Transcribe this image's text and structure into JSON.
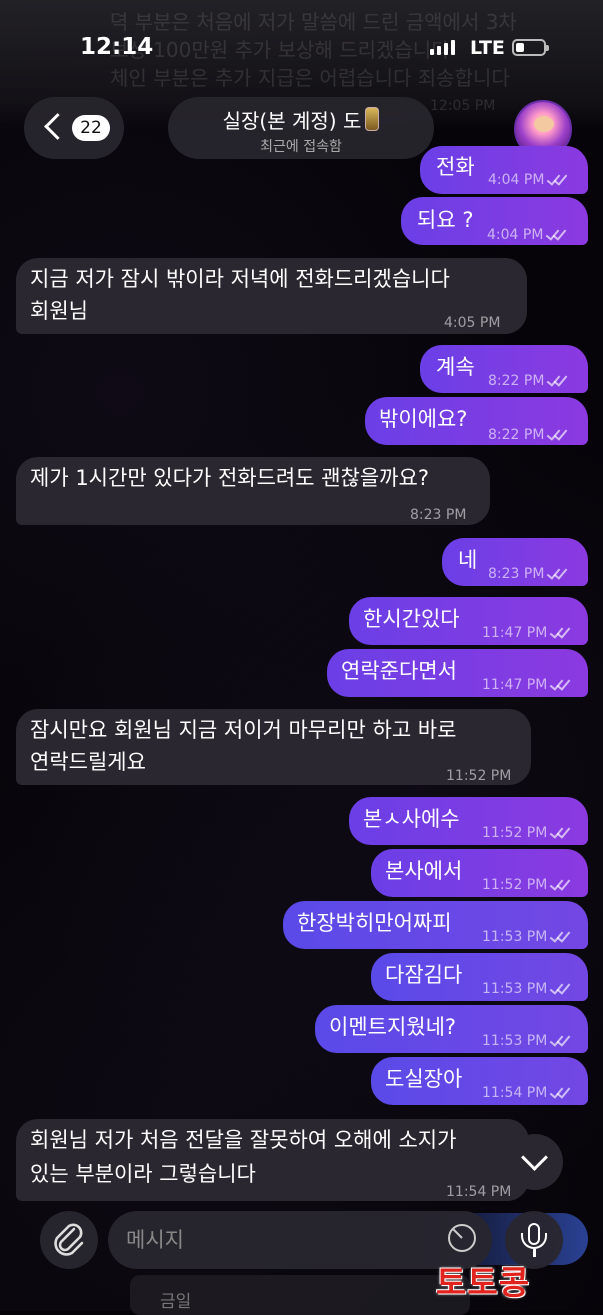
{
  "status": {
    "time": "12:14",
    "network": "LTE"
  },
  "background_overlay": {
    "lines": [
      "뎍 부분은 처음에 저가 말씀에 드린 금액에서 3차",
      "보상 100만원 추가 보상해 드리겠습니다",
      "체인 부분은 추가 지급은 어렵습니다 죄송합니다",
      "12:05 PM"
    ]
  },
  "header": {
    "back_count": "22",
    "title": "실장(본 계정) 도",
    "subtitle": "최근에 접속함"
  },
  "messages": [
    {
      "dir": "out",
      "text": "전화",
      "time": "4:04 PM"
    },
    {
      "dir": "out",
      "text": "되요 ?",
      "time": "4:04 PM"
    },
    {
      "dir": "in",
      "lines": [
        "지금 저가 잠시 밖이라 저녁에 전화드리겠습니다",
        "회원님"
      ],
      "time": "4:05 PM"
    },
    {
      "dir": "out",
      "text": "계속",
      "time": "8:22 PM"
    },
    {
      "dir": "out",
      "text": "밖이에요?",
      "time": "8:22 PM"
    },
    {
      "dir": "in",
      "lines": [
        "제가 1시간만 있다가 전화드려도 괜찮을까요?"
      ],
      "time": "8:23 PM"
    },
    {
      "dir": "out",
      "text": "네",
      "time": "8:23 PM"
    },
    {
      "dir": "out",
      "text": "한시간있다",
      "time": "11:47 PM"
    },
    {
      "dir": "out",
      "text": "연락준다면서",
      "time": "11:47 PM"
    },
    {
      "dir": "in",
      "lines": [
        "잠시만요 회원님 지금 저이거 마무리만 하고 바로",
        "연락드릴게요"
      ],
      "time": "11:52 PM"
    },
    {
      "dir": "out",
      "text": "본ㅅ사에수",
      "time": "11:52 PM"
    },
    {
      "dir": "out",
      "text": "본사에서",
      "time": "11:52 PM"
    },
    {
      "dir": "out",
      "text": "한장박히만어짜피",
      "time": "11:53 PM"
    },
    {
      "dir": "out",
      "text": "다잠김다",
      "time": "11:53 PM"
    },
    {
      "dir": "out",
      "text": "이멘트지웠네?",
      "time": "11:53 PM"
    },
    {
      "dir": "out",
      "text": "도실장아",
      "time": "11:54 PM"
    },
    {
      "dir": "in",
      "lines": [
        "회원님 저가 처음 전달을 잘못하여 오해에 소지가",
        "있는 부분이라 그렇습니다"
      ],
      "time": "11:54 PM"
    }
  ],
  "composer": {
    "placeholder": "메시지"
  },
  "watermark": "토토콩",
  "under_hint": "금일"
}
